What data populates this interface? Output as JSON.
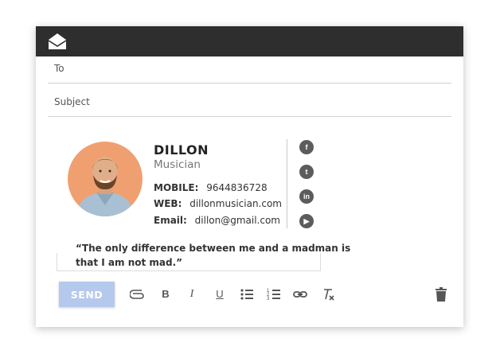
{
  "compose": {
    "to_label": "To",
    "subject_label": "Subject"
  },
  "signature": {
    "name": "DILLON",
    "role": "Musician",
    "mobile_label": "MOBILE:",
    "mobile": "9644836728",
    "web_label": "WEB:",
    "web": "dillonmusician.com",
    "email_label": "Email:",
    "email": "dillon@gmail.com",
    "social": [
      {
        "icon": "facebook-icon",
        "glyph": "f"
      },
      {
        "icon": "twitter-icon",
        "glyph": "t"
      },
      {
        "icon": "linkedin-icon",
        "glyph": "in"
      },
      {
        "icon": "youtube-icon",
        "glyph": "▶"
      }
    ],
    "quote": "“The only difference between me and a madman is that I am not mad.”"
  },
  "toolbar": {
    "send_label": "SEND",
    "bold": "B",
    "italic": "I",
    "underline": "U"
  },
  "colors": {
    "titlebar": "#2e2e2e",
    "send": "#b5c9ec",
    "avatar_bg": "#f0a070"
  }
}
